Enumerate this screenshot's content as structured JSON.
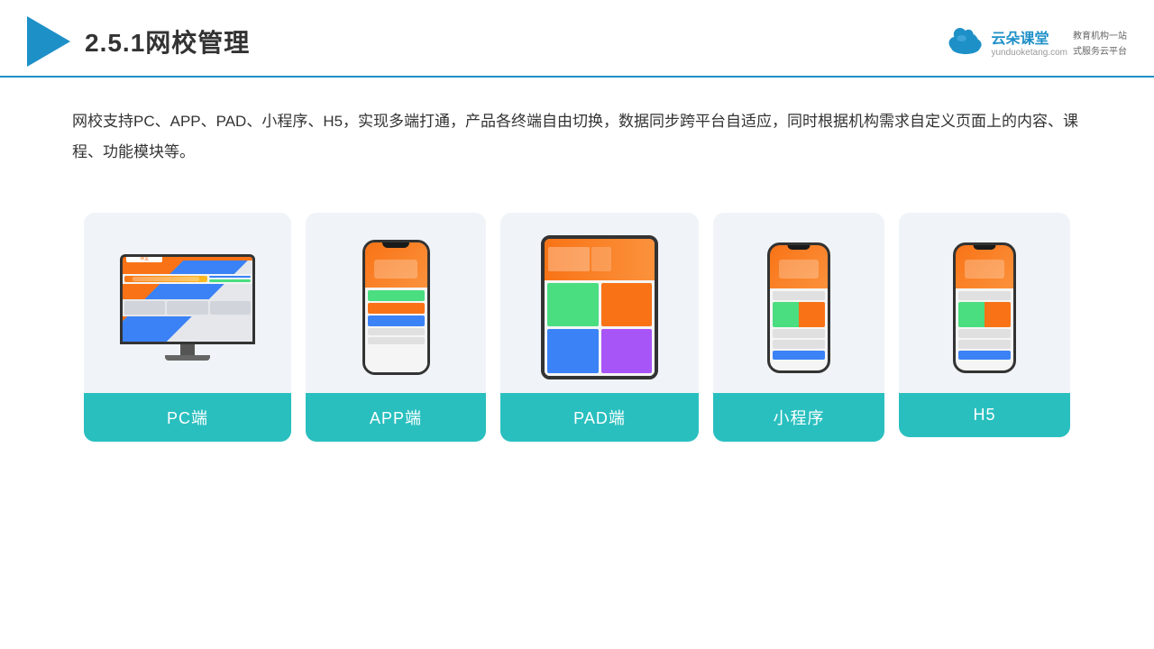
{
  "header": {
    "title": "2.5.1网校管理",
    "brand": {
      "name": "云朵课堂",
      "url": "yunduoketang.com",
      "tagline": "教育机构一站",
      "tagline2": "式服务云平台"
    }
  },
  "description": {
    "text": "网校支持PC、APP、PAD、小程序、H5，实现多端打通，产品各终端自由切换，数据同步跨平台自适应，同时根据机构需求自定义页面上的内容、课程、功能模块等。"
  },
  "cards": [
    {
      "id": "pc",
      "label": "PC端"
    },
    {
      "id": "app",
      "label": "APP端"
    },
    {
      "id": "pad",
      "label": "PAD端"
    },
    {
      "id": "mini",
      "label": "小程序"
    },
    {
      "id": "h5",
      "label": "H5"
    }
  ],
  "colors": {
    "accent": "#1e90c8",
    "teal": "#2abfbf",
    "divider": "#1e90c8"
  }
}
